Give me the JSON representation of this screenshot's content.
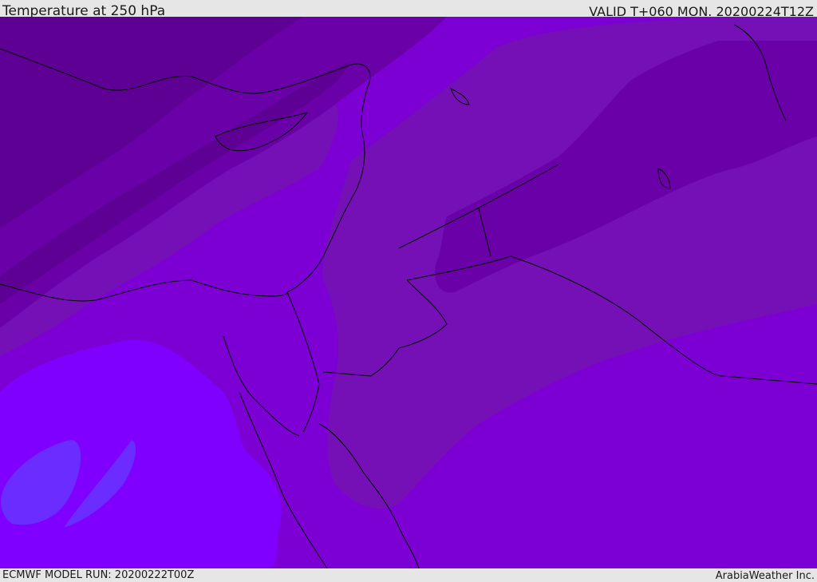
{
  "header": {
    "title": "Temperature at 250 hPa",
    "valid_time": "VALID T+060 MON. 20200224T12Z"
  },
  "footer": {
    "model_run": "ECMWF MODEL RUN: 20200222T00Z",
    "credit": "ArabiaWeather Inc."
  },
  "colors": {
    "band_coldest": "#5f0095",
    "band_cold": "#6a00a8",
    "band_mid": "#7510b6",
    "band_warm": "#7c00d4",
    "band_warmer": "#7f00ff",
    "band_warmest": "#6a2cff",
    "coastline": "#000000",
    "frame": "#e6e6e6"
  }
}
